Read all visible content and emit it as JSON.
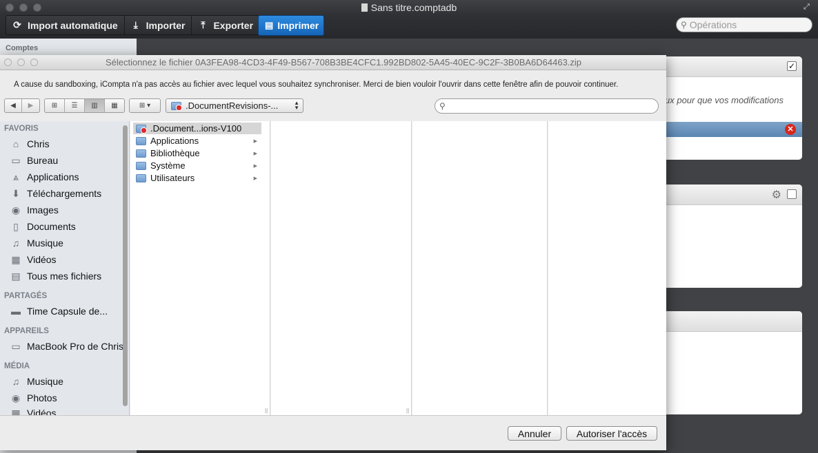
{
  "app": {
    "title": "Sans titre.comptadb"
  },
  "toolbar": {
    "import_auto": "Import automatique",
    "importer": "Importer",
    "exporter": "Exporter",
    "imprimer": "Imprimer",
    "search_placeholder": "Opérations"
  },
  "sidebar": {
    "header": "Comptes"
  },
  "panels": {
    "message_fragment": "ux pour que vos modifications"
  },
  "dialog": {
    "title": "Sélectionnez le fichier 0A3FEA98-4CD3-4F49-B567-708B3BE4CFC1.992BD802-5A45-40EC-9C2F-3B0BA6D64463.zip",
    "message": "A cause du sandboxing, iCompta n'a pas accès au fichier avec lequel vous souhaitez synchroniser. Merci de bien vouloir l'ouvrir dans cette fenêtre afin de pouvoir continuer.",
    "location": ".DocumentRevisions-...",
    "sections": {
      "favoris": "FAVORIS",
      "partages": "PARTAGÉS",
      "appareils": "APPAREILS",
      "media": "MÉDIA"
    },
    "favoris": [
      {
        "label": "Chris",
        "icon": "home-icon"
      },
      {
        "label": "Bureau",
        "icon": "desktop-icon"
      },
      {
        "label": "Applications",
        "icon": "applications-icon"
      },
      {
        "label": "Téléchargements",
        "icon": "downloads-icon"
      },
      {
        "label": "Images",
        "icon": "camera-icon"
      },
      {
        "label": "Documents",
        "icon": "document-icon"
      },
      {
        "label": "Musique",
        "icon": "music-icon"
      },
      {
        "label": "Vidéos",
        "icon": "film-icon"
      },
      {
        "label": "Tous mes fichiers",
        "icon": "all-files-icon"
      }
    ],
    "partages": [
      {
        "label": "Time Capsule de...",
        "icon": "network-drive-icon"
      }
    ],
    "appareils": [
      {
        "label": "MacBook Pro de Chris",
        "icon": "laptop-icon"
      }
    ],
    "media": [
      {
        "label": "Musique",
        "icon": "music-icon"
      },
      {
        "label": "Photos",
        "icon": "camera-icon"
      },
      {
        "label": "Vidéos",
        "icon": "film-icon"
      }
    ],
    "column1": [
      {
        "label": ".Document...ions-V100",
        "selected": true
      },
      {
        "label": "Applications",
        "selected": false
      },
      {
        "label": "Bibliothèque",
        "selected": false
      },
      {
        "label": "Système",
        "selected": false
      },
      {
        "label": "Utilisateurs",
        "selected": false
      }
    ],
    "cancel": "Annuler",
    "allow": "Autoriser l'accès"
  }
}
